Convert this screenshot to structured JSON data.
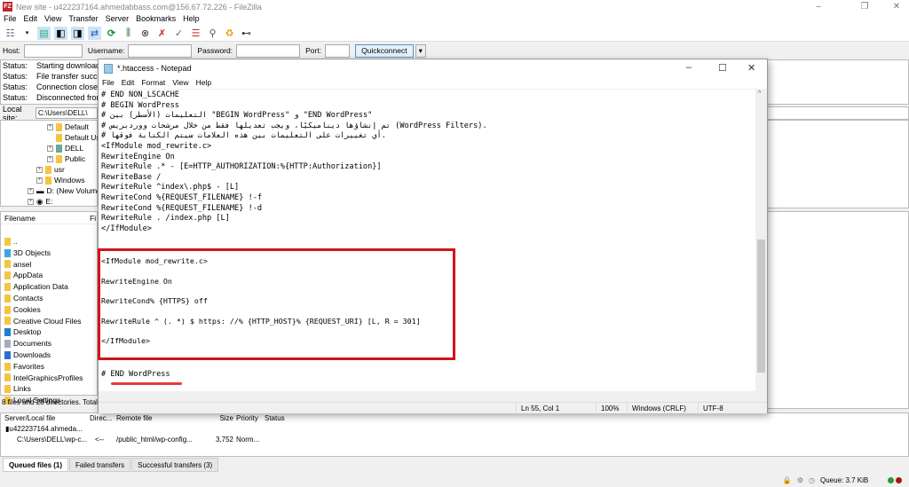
{
  "window": {
    "title": "New site - u422237164.ahmedabbass.com@156.67.72.226 - FileZilla",
    "logo": "FZ"
  },
  "menu": [
    "File",
    "Edit",
    "View",
    "Transfer",
    "Server",
    "Bookmarks",
    "Help"
  ],
  "toolbar_icons": [
    "site-manager-icon",
    "toggle-log-icon",
    "toggle-local-tree-icon",
    "toggle-remote-tree-icon",
    "toggle-queue-icon",
    "refresh-icon",
    "process-queue-icon",
    "cancel-icon",
    "disconnect-icon",
    "reconnect-icon",
    "filter-icon",
    "compare-icon",
    "sync-browse-icon",
    "search-icon"
  ],
  "quickconnect": {
    "host_label": "Host:",
    "username_label": "Username:",
    "password_label": "Password:",
    "port_label": "Port:",
    "button": "Quickconnect",
    "host": "",
    "username": "",
    "password": "",
    "port": ""
  },
  "log": [
    {
      "k": "Status:",
      "v": "Starting download of"
    },
    {
      "k": "Status:",
      "v": "File transfer successful"
    },
    {
      "k": "Status:",
      "v": "Connection closed by"
    },
    {
      "k": "Status:",
      "v": "Disconnected from"
    }
  ],
  "local_site": {
    "label": "Local site:",
    "path": "C:\\Users\\DELL\\"
  },
  "tree": [
    "Default",
    "Default User",
    "DELL",
    "Public",
    "usr",
    "Windows",
    "D: (New Volume)",
    "E:"
  ],
  "file_list": {
    "header": "Filename",
    "header2": "Fi",
    "rows": [
      "..",
      "3D Objects",
      "ansel",
      "AppData",
      "Application Data",
      "Contacts",
      "Cookies",
      "Creative Cloud Files",
      "Desktop",
      "Documents",
      "Downloads",
      "Favorites",
      "IntelGraphicsProfiles",
      "Links",
      "Local Settings"
    ],
    "status": "8 files and 28 directories. Total"
  },
  "queue": {
    "headers": [
      "Server/Local file",
      "Direc...",
      "Remote file",
      "Size",
      "Priority",
      "Status"
    ],
    "server": "u422237164.ahmeda...",
    "row": {
      "local": "C:\\Users\\DELL\\wp-c...",
      "dir": "<--",
      "remote": "/public_html/wp-config...",
      "size": "3,752",
      "priority": "Norm..."
    }
  },
  "tabs": [
    "Queued files (1)",
    "Failed transfers",
    "Successful transfers (3)"
  ],
  "statusbar": {
    "queue": "Queue: 3.7 KiB"
  },
  "notepad": {
    "title": "*.htaccess - Notepad",
    "menu": [
      "File",
      "Edit",
      "Format",
      "View",
      "Help"
    ],
    "lines": [
      "# END NON_LSCACHE",
      "# BEGIN WordPress",
      "# التعليمات (الأسطر) بين \"BEGIN WordPress\" و \"END WordPress\"",
      "# تم إنشاؤها ديناميكيًا، ويجب تعديلها فقط من خلال مرشحات ووردبريس (WordPress Filters).",
      "# أي تغييرات على التعليمات بين هذه العلامات سيتم الكتابة فوقها.",
      "<IfModule mod_rewrite.c>",
      "RewriteEngine On",
      "RewriteRule .* - [E=HTTP_AUTHORIZATION:%{HTTP:Authorization}]",
      "RewriteBase /",
      "RewriteRule ^index\\.php$ - [L]",
      "RewriteCond %{REQUEST_FILENAME} !-f",
      "RewriteCond %{REQUEST_FILENAME} !-d",
      "RewriteRule . /index.php [L]",
      "</IfModule>"
    ],
    "highlighted": [
      "<IfModule mod_rewrite.c>",
      "RewriteEngine On",
      "RewriteCond% {HTTPS} off",
      "RewriteRule ^ (. *) $ https: //% {HTTP_HOST}% {REQUEST_URI} [L, R = 301]",
      "</IfModule>"
    ],
    "end_line": "# END WordPress",
    "status": {
      "position": "Ln 55, Col 1",
      "zoom": "100%",
      "eol": "Windows (CRLF)",
      "encoding": "UTF-8"
    }
  },
  "colors": {
    "highlight": "#d0141b",
    "accent": "#0078d7"
  }
}
